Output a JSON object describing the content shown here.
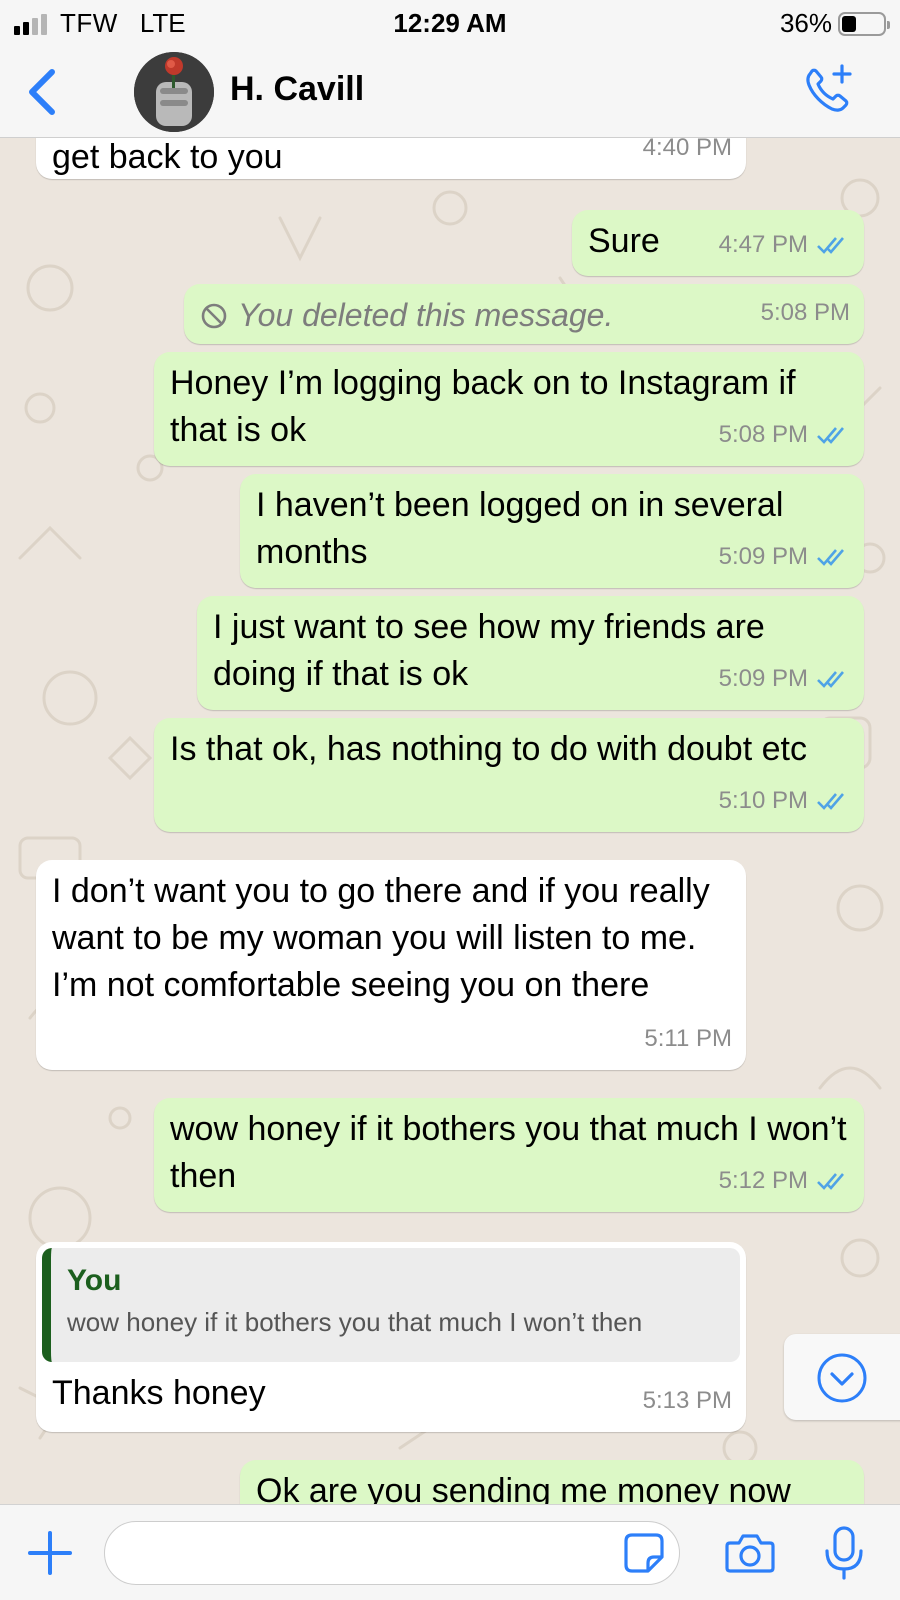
{
  "status_bar": {
    "carrier": "TFW",
    "network": "LTE",
    "time": "12:29 AM",
    "battery_label": "36%",
    "battery_level": 0.36,
    "signal_bars_active": 2,
    "signal_bars_total": 4
  },
  "header": {
    "back_icon": "chevron-left-icon",
    "contact_name": "H. Cavill",
    "call_icon": "add-call-icon",
    "accent_color": "#2d7ff9"
  },
  "colors": {
    "outgoing_bubble": "#dcf8c6",
    "incoming_bubble": "#ffffff",
    "read_ticks": "#4fa3e6",
    "quote_bar": "#1c5f1e"
  },
  "messages": [
    {
      "direction": "in",
      "text": "get back to you",
      "time": "4:40 PM"
    },
    {
      "direction": "out",
      "text": "Sure",
      "time": "4:47 PM",
      "status": "read"
    },
    {
      "direction": "out",
      "deleted": true,
      "text": "You deleted this message.",
      "time": "5:08 PM"
    },
    {
      "direction": "out",
      "text": "Honey I’m logging back on to Instagram if that is ok",
      "time": "5:08 PM",
      "status": "read"
    },
    {
      "direction": "out",
      "text": "I haven’t been logged on in several months",
      "time": "5:09 PM",
      "status": "read"
    },
    {
      "direction": "out",
      "text": "I just want to see how my friends are doing if that is ok",
      "time": "5:09 PM",
      "status": "read"
    },
    {
      "direction": "out",
      "text": "Is that ok, has nothing to do with doubt etc",
      "time": "5:10 PM",
      "status": "read"
    },
    {
      "direction": "in",
      "text": "I don’t want you to go there and if you really want to be my woman you will listen to me. I’m not comfortable seeing you on there",
      "time": "5:11 PM"
    },
    {
      "direction": "out",
      "text": "wow honey if it bothers you that much I won’t then",
      "time": "5:12 PM",
      "status": "read"
    },
    {
      "direction": "in",
      "quote": {
        "author": "You",
        "text": "wow honey if it bothers you that much I won’t then"
      },
      "text": "Thanks honey",
      "time": "5:13 PM"
    },
    {
      "direction": "out",
      "text": "Ok are you sending me money now",
      "time": ""
    }
  ],
  "scroll_down_icon": "chevron-down-circle-icon",
  "input_bar": {
    "plus_icon": "plus-icon",
    "placeholder": "",
    "value": "",
    "sticker_icon": "sticker-icon",
    "camera_icon": "camera-icon",
    "mic_icon": "microphone-icon"
  }
}
